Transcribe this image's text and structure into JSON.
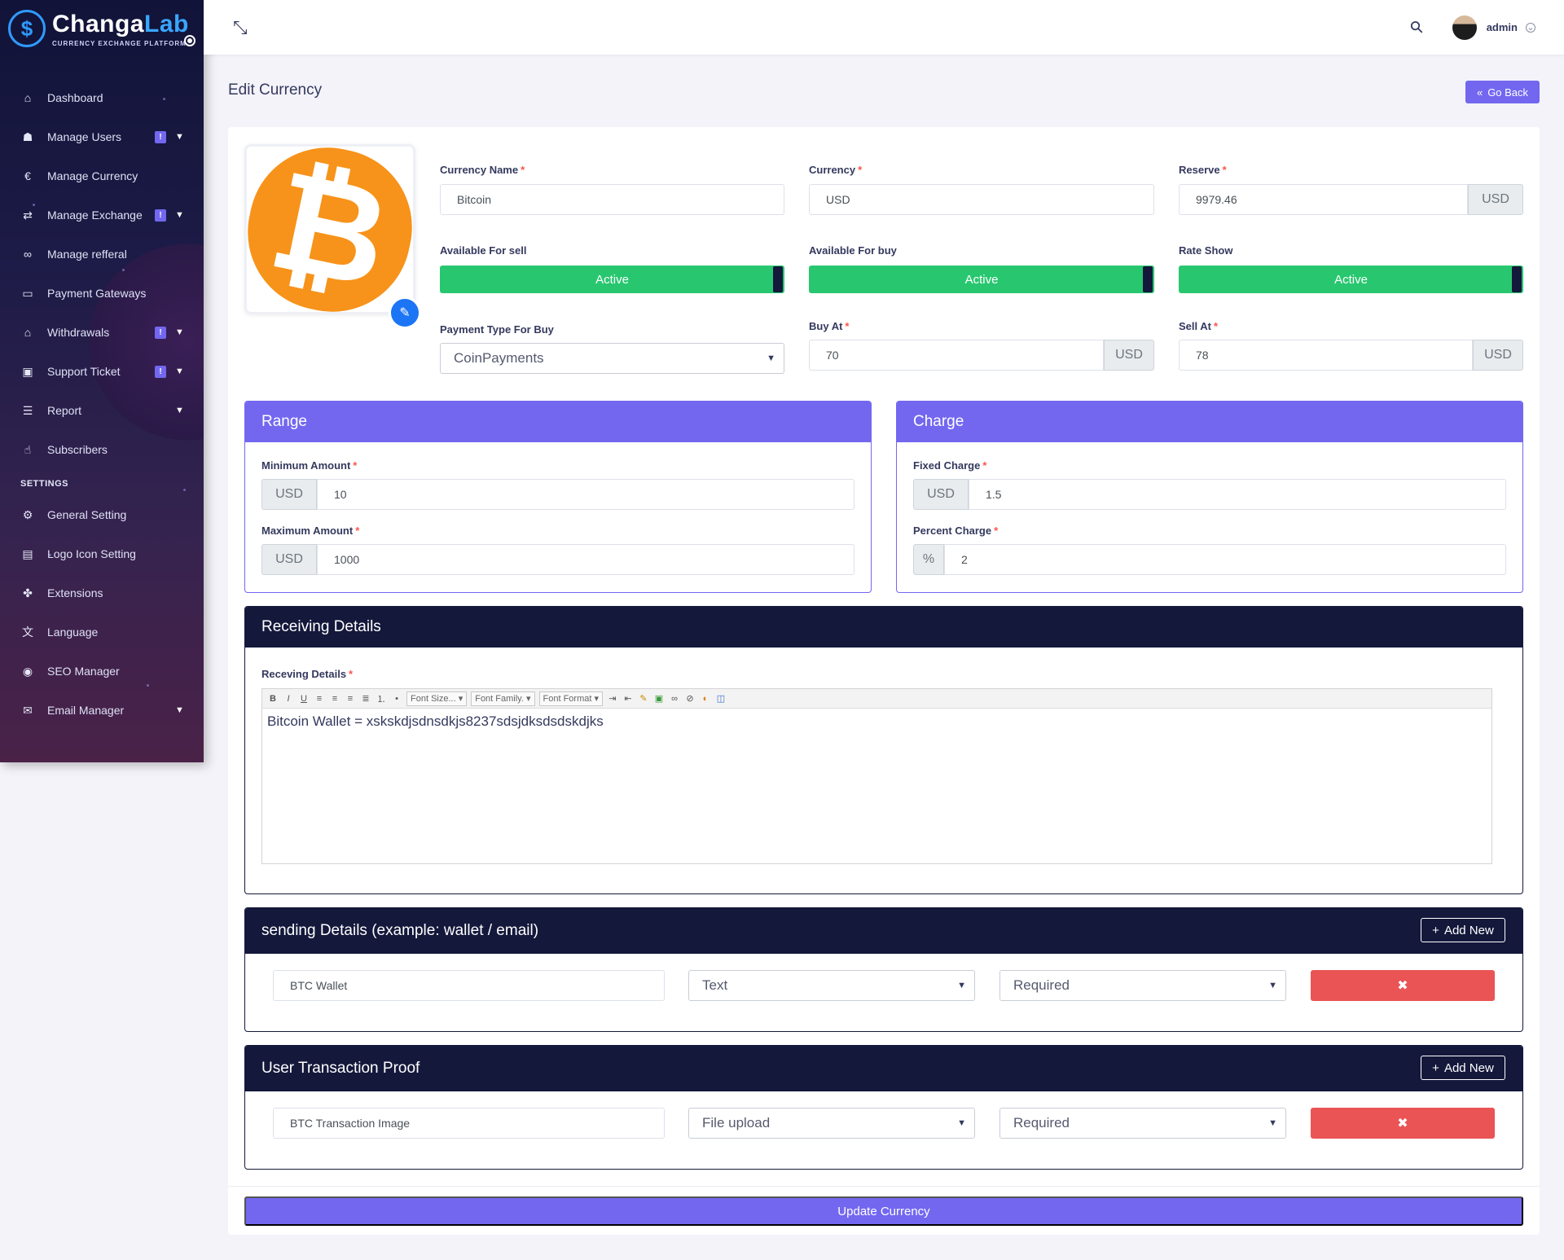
{
  "brand": {
    "name_a": "Changa",
    "name_b": "Lab",
    "tagline": "CURRENCY EXCHANGE PLATFORM"
  },
  "sidebar": {
    "items": [
      {
        "label": "Dashboard",
        "icon": "home-icon",
        "badge": "",
        "caret": false
      },
      {
        "label": "Manage Users",
        "icon": "users-icon",
        "badge": "!",
        "caret": true
      },
      {
        "label": "Manage Currency",
        "icon": "euro-icon",
        "badge": "",
        "caret": false
      },
      {
        "label": "Manage Exchange",
        "icon": "exchange-icon",
        "badge": "!",
        "caret": true
      },
      {
        "label": "Manage refferal",
        "icon": "link-icon",
        "badge": "",
        "caret": false
      },
      {
        "label": "Payment Gateways",
        "icon": "credit-card-icon",
        "badge": "",
        "caret": false
      },
      {
        "label": "Withdrawals",
        "icon": "bank-icon",
        "badge": "!",
        "caret": true
      },
      {
        "label": "Support Ticket",
        "icon": "ticket-icon",
        "badge": "!",
        "caret": true
      },
      {
        "label": "Report",
        "icon": "list-icon",
        "badge": "",
        "caret": true
      },
      {
        "label": "Subscribers",
        "icon": "thumbs-up-icon",
        "badge": "",
        "caret": false
      }
    ],
    "settings_title": "SETTINGS",
    "settings_items": [
      {
        "label": "General Setting",
        "icon": "cog-icon",
        "caret": false
      },
      {
        "label": "Logo Icon Setting",
        "icon": "image-icon",
        "caret": false
      },
      {
        "label": "Extensions",
        "icon": "puzzle-icon",
        "caret": false
      },
      {
        "label": "Language",
        "icon": "language-icon",
        "caret": false
      },
      {
        "label": "SEO Manager",
        "icon": "globe-icon",
        "caret": false
      },
      {
        "label": "Email Manager",
        "icon": "envelope-icon",
        "caret": true
      }
    ]
  },
  "topbar": {
    "user": "admin"
  },
  "page": {
    "title": "Edit Currency",
    "go_back": "Go Back"
  },
  "form": {
    "currency_name": {
      "label": "Currency Name",
      "value": "Bitcoin"
    },
    "currency": {
      "label": "Currency",
      "value": "USD"
    },
    "reserve": {
      "label": "Reserve",
      "value": "9979.46",
      "unit": "USD"
    },
    "available_sell": {
      "label": "Available For sell",
      "state": "Active"
    },
    "available_buy": {
      "label": "Available For buy",
      "state": "Active"
    },
    "rate_show": {
      "label": "Rate Show",
      "state": "Active"
    },
    "payment_type": {
      "label": "Payment Type For Buy",
      "value": "CoinPayments"
    },
    "buy_at": {
      "label": "Buy At",
      "value": "70",
      "unit": "USD"
    },
    "sell_at": {
      "label": "Sell At",
      "value": "78",
      "unit": "USD"
    },
    "required_mark": "*"
  },
  "range": {
    "title": "Range",
    "min": {
      "label": "Minimum Amount",
      "unit": "USD",
      "value": "10"
    },
    "max": {
      "label": "Maximum Amount",
      "unit": "USD",
      "value": "1000"
    }
  },
  "charge": {
    "title": "Charge",
    "fixed": {
      "label": "Fixed Charge",
      "unit": "USD",
      "value": "1.5"
    },
    "percent": {
      "label": "Percent Charge",
      "unit": "%",
      "value": "2"
    }
  },
  "receiving": {
    "title": "Receiving Details",
    "label": "Receving Details",
    "toolbar": {
      "font_size": "Font Size...",
      "font_family": "Font Family.",
      "font_format": "Font Format"
    },
    "content": "Bitcoin Wallet = xskskdjsdnsdkjs8237sdsjdksdsdskdjks"
  },
  "sending": {
    "title": "sending Details (example: wallet / email)",
    "add_new": "Add New",
    "row": {
      "name": "BTC Wallet",
      "type": "Text",
      "required": "Required"
    }
  },
  "proof": {
    "title": "User Transaction Proof",
    "add_new": "Add New",
    "row": {
      "name": "BTC Transaction Image",
      "type": "File upload",
      "required": "Required"
    }
  },
  "submit": "Update Currency",
  "colors": {
    "primary": "#7367f0",
    "success": "#28c76f",
    "danger": "#ea5455",
    "dark": "#14183b",
    "btc": "#f7931a"
  }
}
